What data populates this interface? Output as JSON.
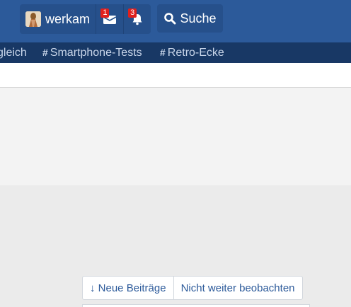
{
  "header": {
    "username": "werkam",
    "inbox_badge": "1",
    "alerts_badge": "3",
    "search_label": "Suche"
  },
  "tags": [
    {
      "label": "gleich"
    },
    {
      "label": "Smartphone-Tests"
    },
    {
      "label": "Retro-Ecke"
    }
  ],
  "actions": {
    "new_posts_label": "↓ Neue Beiträge",
    "unwatch_label": "Nicht weiter beobachten"
  }
}
